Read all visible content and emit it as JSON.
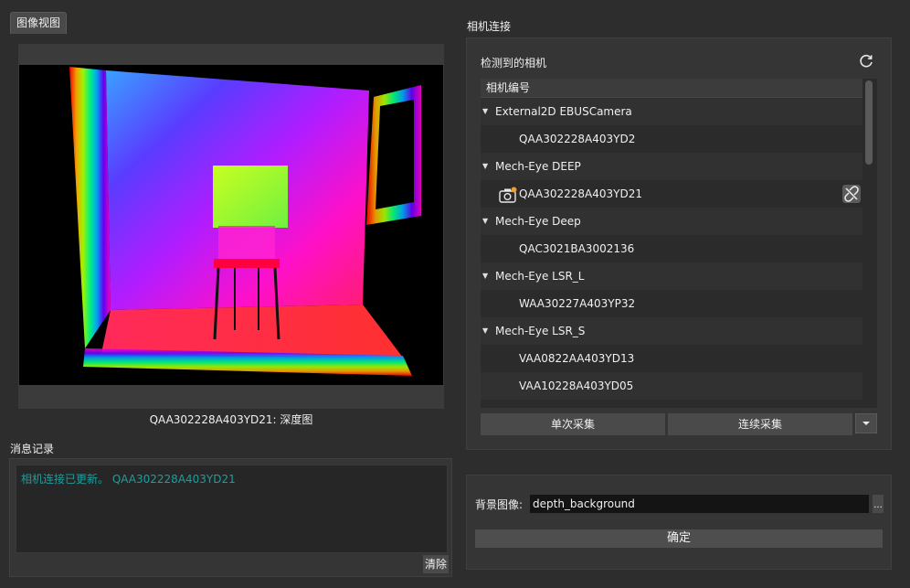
{
  "image_view": {
    "tab_label": "图像视图",
    "caption": "QAA302228A403YD21: 深度图"
  },
  "messages": {
    "title": "消息记录",
    "log": "相机连接已更新。 QAA302228A403YD21",
    "clear_label": "清除"
  },
  "camera_connection": {
    "title": "相机连接",
    "detected_label": "检测到的相机",
    "refresh_icon": "refresh-icon",
    "tree_header": "相机编号",
    "groups": [
      {
        "name": "External2D EBUSCamera",
        "serials": [
          "QAA302228A403YD2"
        ]
      },
      {
        "name": "Mech-Eye DEEP",
        "serials": [
          "QAA302228A403YD21"
        ]
      },
      {
        "name": "Mech-Eye Deep",
        "serials": [
          "QAC3021BA3002136"
        ]
      },
      {
        "name": "Mech-Eye LSR_L",
        "serials": [
          "WAA30227A403YP32"
        ]
      },
      {
        "name": "Mech-Eye LSR_S",
        "serials": [
          "VAA0822AA403YD13",
          "VAA10228A403YD05"
        ]
      }
    ],
    "single_capture_label": "单次采集",
    "continuous_capture_label": "连续采集"
  },
  "background": {
    "label": "背景图像:",
    "value": "depth_background",
    "browse_label": "...",
    "confirm_label": "确定"
  },
  "colors": {
    "background": "#2d2d2d",
    "panel": "#353535",
    "log_text": "#1f9d9d",
    "connected_dot": "#f0a030"
  }
}
